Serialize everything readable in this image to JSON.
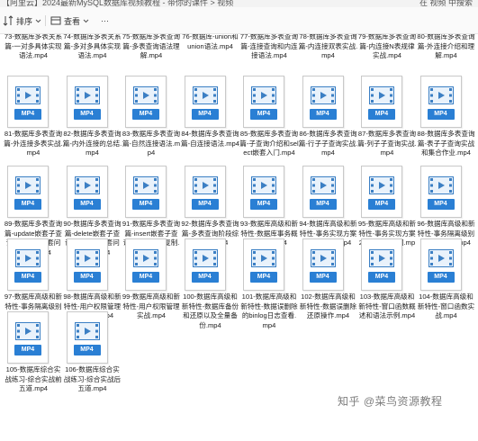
{
  "window": {
    "path_text": "【阿里云】2024最新MySQL数据库视频教程 - 带你的课件 > 视频",
    "search_placeholder": "在 视频 中搜索"
  },
  "toolbar": {
    "sort_label": "排序",
    "view_label": "查看"
  },
  "files": [
    {
      "name": "73-数据库多表关系篇-一对多具体实现语法.mp4",
      "badge": "MP4"
    },
    {
      "name": "74-数据库多表关系篇-多对多具体实现语法.mp4",
      "badge": "MP4"
    },
    {
      "name": "75-数据库多表查询篇-多表查询语法理解.mp4",
      "badge": "MP4"
    },
    {
      "name": "76-数据库-union和union语法.mp4",
      "badge": "MP4"
    },
    {
      "name": "77-数据库多表查询篇-连接查询和内连接语法.mp4",
      "badge": "MP4"
    },
    {
      "name": "78-数据库多表查询篇-内连接双表实战.mp4",
      "badge": "MP4"
    },
    {
      "name": "79-数据库多表查询篇-内连接N表规律实战.mp4",
      "badge": "MP4"
    },
    {
      "name": "80-数据库多表查询篇-外连接介绍和理解.mp4",
      "badge": "MP4"
    },
    {
      "name": "81-数据库多表查询篇-外连接多表实战.mp4",
      "badge": "MP4"
    },
    {
      "name": "82-数据库多表查询篇-内外连接的总结.mp4",
      "badge": "MP4"
    },
    {
      "name": "83-数据库多表查询篇-自然连接语法.mp4",
      "badge": "MP4"
    },
    {
      "name": "84-数据库多表查询篇-自连接语法.mp4",
      "badge": "MP4"
    },
    {
      "name": "85-数据库多表查询篇-子查询介绍和select嵌套入门.mp4",
      "badge": "MP4"
    },
    {
      "name": "86-数据库多表查询篇-行子子查询实战.mp4",
      "badge": "MP4"
    },
    {
      "name": "87-数据库多表查询篇-列子子查询实战.mp4",
      "badge": "MP4"
    },
    {
      "name": "88-数据库多表查询篇-表子子查询实战和集合作业.mp4",
      "badge": "MP4"
    },
    {
      "name": "89-数据库多表查询篇-update嵌套子查询以及同表嵌套问题解决.mp4",
      "badge": "MP4"
    },
    {
      "name": "90-数据库多表查询篇-delete嵌套子查询以及同表嵌套问题解决.mp4",
      "badge": "MP4"
    },
    {
      "name": "91-数据库多表查询篇-insert嵌套子查询以及表结构复制.mp4",
      "badge": "MP4"
    },
    {
      "name": "92-数据库多表查询篇-多表查询阶段综合实战.mp4",
      "badge": "MP4"
    },
    {
      "name": "93-数据库高级和新特性-数据库事务概念理解.mp4",
      "badge": "MP4"
    },
    {
      "name": "94-数据库高级和新特性-事务实现方案1手动提交.mp4",
      "badge": "MP4"
    },
    {
      "name": "95-数据库高级和新特性-事务实现方案2独立事务空间.mp4",
      "badge": "MP4"
    },
    {
      "name": "96-数据库高级和新特性-事务隔离级别和问题说明.mp4",
      "badge": "MP4"
    },
    {
      "name": "97-数据库高级和新特性-事务隔离级别演示.mp4",
      "badge": "MP4"
    },
    {
      "name": "98-数据库高级和新特性-用户权限管理篇和介绍.mp4",
      "badge": "MP4"
    },
    {
      "name": "99-数据库高级和新特性-用户权限管理实战.mp4",
      "badge": "MP4"
    },
    {
      "name": "100-数据库高级和新特性-数据库备份和还原以及全量备份.mp4",
      "badge": "MP4"
    },
    {
      "name": "101-数据库高级和新特性-数据误删除的binlog日志查看.mp4",
      "badge": "MP4"
    },
    {
      "name": "102-数据库高级和新特性-数据误删除还原操作.mp4",
      "badge": "MP4"
    },
    {
      "name": "103-数据库高级和新特性-窗口函数概述和语法示例.mp4",
      "badge": "MP4"
    },
    {
      "name": "104-数据库高级和新特性-窗口函数实战.mp4",
      "badge": "MP4"
    },
    {
      "name": "105-数据库综合实战练习-综合实战前五道.mp4",
      "badge": "MP4"
    },
    {
      "name": "106-数据库综合实战练习-综合实战后五道.mp4",
      "badge": "MP4"
    }
  ],
  "watermark": "知乎 @菜鸟资源教程"
}
